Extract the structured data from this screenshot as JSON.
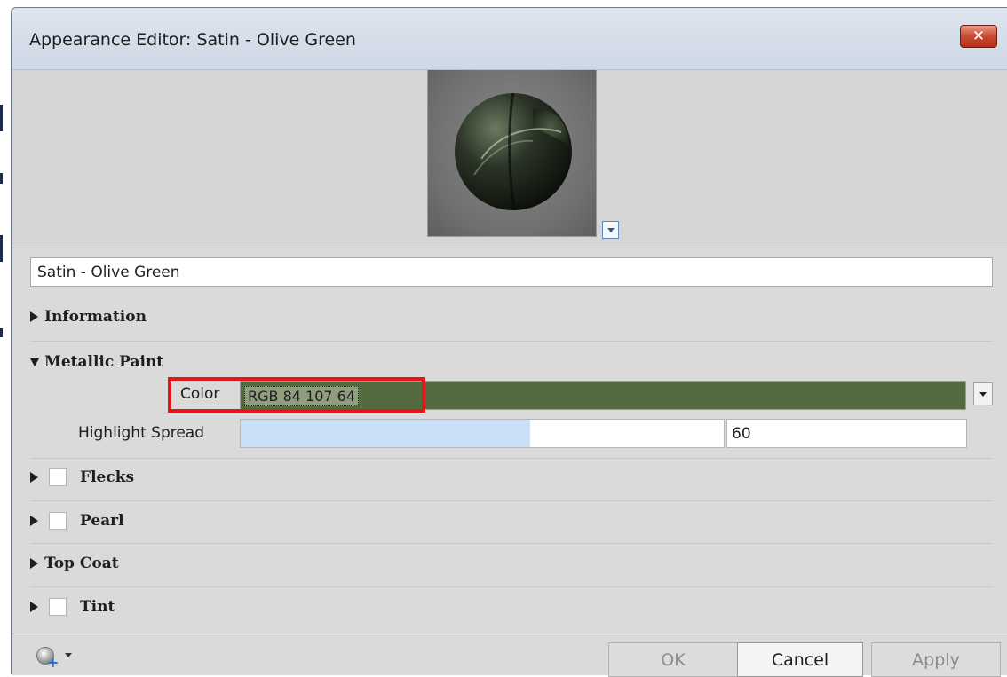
{
  "window": {
    "title": "Appearance Editor: Satin - Olive Green"
  },
  "material_name": "Satin - Olive Green",
  "sections": {
    "information": "Information",
    "metallic_paint": "Metallic Paint",
    "flecks": "Flecks",
    "pearl": "Pearl",
    "top_coat": "Top Coat",
    "tint": "Tint"
  },
  "metallic_paint": {
    "color_label": "Color",
    "color_value": "RGB 84 107 64",
    "color_hex": "#546b40",
    "highlight_label": "Highlight Spread",
    "highlight_value": "60",
    "highlight_fraction": 0.6
  },
  "checkboxes": {
    "flecks": false,
    "pearl": false,
    "tint": false
  },
  "buttons": {
    "ok": "OK",
    "cancel": "Cancel",
    "apply": "Apply"
  },
  "icons": {
    "close": "close-icon",
    "preview_menu": "chevron-down-icon",
    "globe": "globe-add-icon"
  },
  "colors": {
    "accent_highlight": "#e8141b",
    "slider_fill": "#c9e0f6"
  }
}
